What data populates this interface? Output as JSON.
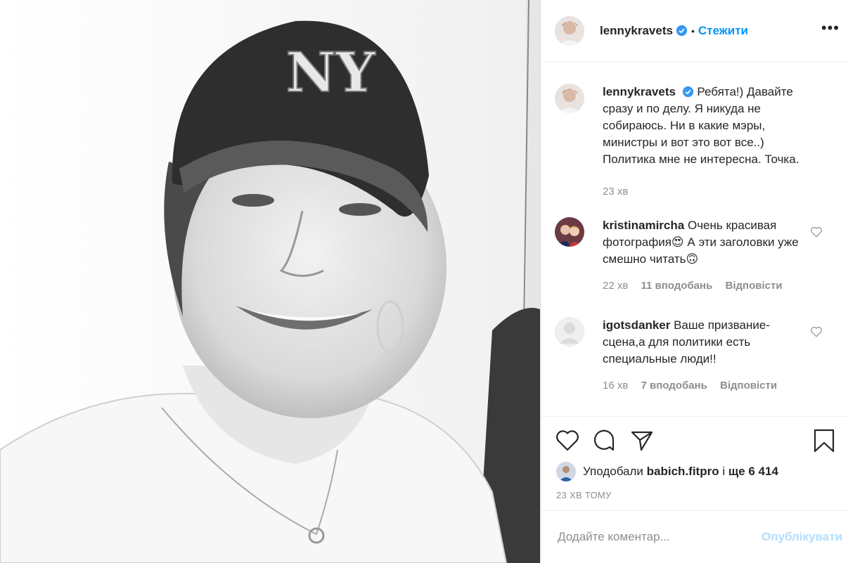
{
  "post": {
    "author": "lennykravets",
    "verified": true,
    "follow_label": "Стежити",
    "dot": "•",
    "more_label": "•••"
  },
  "caption": {
    "author": "lennykravets",
    "text": "Ребята!) Давайте сразу и по делу. Я никуда не собираюсь. Ни в какие мэры, министры и вот это вот все..) Политика мне не интересна. Точка.",
    "time": "23 хв"
  },
  "comments": [
    {
      "author": "kristinamircha",
      "text_part1": "Очень красивая фотография",
      "emoji1": "😍",
      "text_part2": " А эти заголовки уже смешно читать",
      "emoji2": "🙃",
      "time": "22 хв",
      "likes": "11 вподобань",
      "reply": "Відповісти"
    },
    {
      "author": "igotsdanker",
      "text": "Ваше призвание-сцена,а для политики есть специальные люди!!",
      "time": "16 хв",
      "likes": "7 вподобань",
      "reply": "Відповісти"
    }
  ],
  "likes": {
    "prefix": "Уподобали",
    "user": "babich.fitpro",
    "middle": "і",
    "count": "ще 6 414"
  },
  "timestamp": "23 ХВ ТОМУ",
  "add_comment": {
    "placeholder": "Додайте коментар...",
    "publish": "Опублікувати"
  },
  "icons": [
    "heart-icon",
    "comment-icon",
    "share-icon",
    "bookmark-icon",
    "verified-icon",
    "more-icon"
  ],
  "colors": {
    "accent": "#0095f6",
    "publish_disabled": "#b2dffc",
    "muted": "#8e8e8e",
    "text": "#262626"
  }
}
